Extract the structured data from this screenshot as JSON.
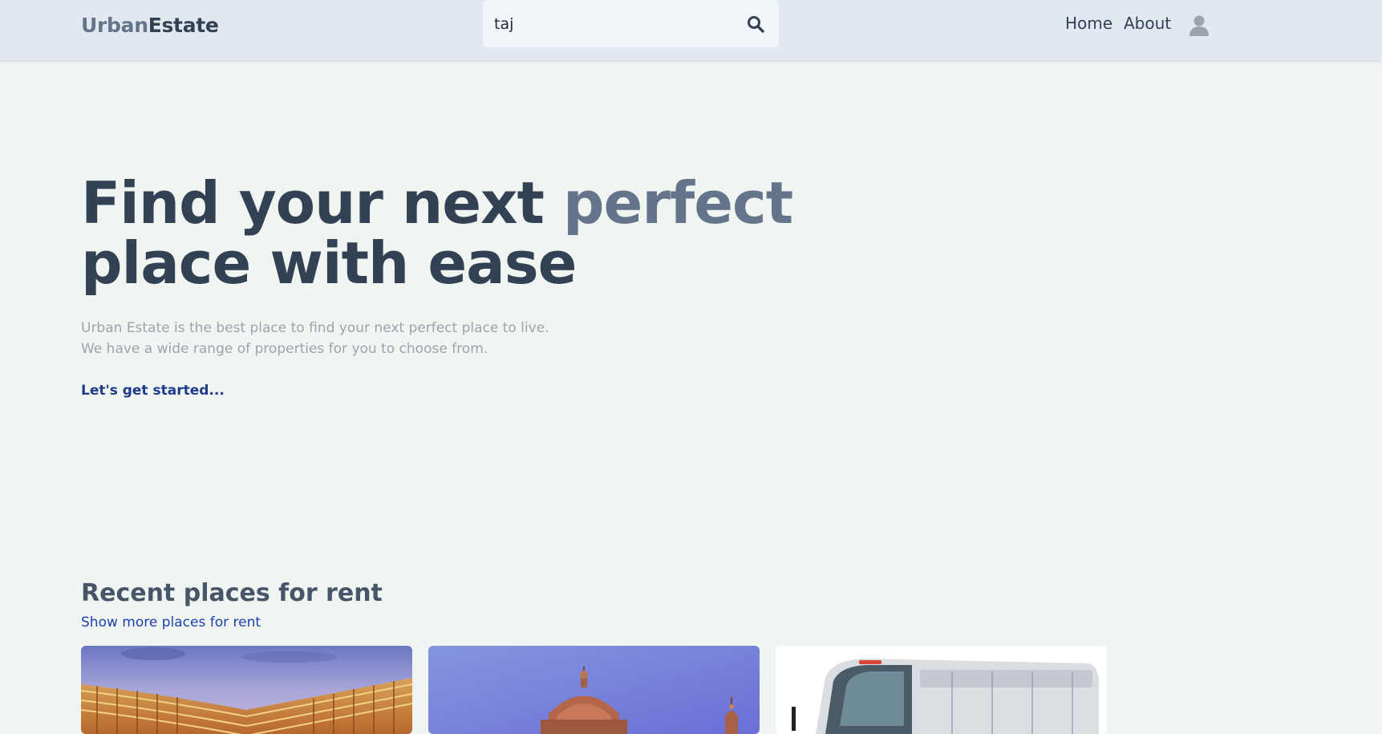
{
  "header": {
    "logo_part1": "Urban",
    "logo_part2": "Estate",
    "search_value": "taj",
    "nav_home": "Home",
    "nav_about": "About"
  },
  "hero": {
    "title_part1": "Find your next ",
    "title_accent": "perfect",
    "title_part2": "place with ease",
    "subtitle_line1": "Urban Estate is the best place to find your next perfect place to live.",
    "subtitle_line2": "We have a wide range of properties for you to choose from.",
    "cta": "Let's get started..."
  },
  "recent": {
    "title": "Recent places for rent",
    "show_more": "Show more places for rent"
  },
  "colors": {
    "background": "#f1f5f1",
    "header": "#e2e8f0",
    "logo_light": "#64748b",
    "logo_dark": "#334155",
    "cta": "#1e3a8a"
  },
  "icons": [
    "search-icon",
    "user-avatar-icon"
  ]
}
